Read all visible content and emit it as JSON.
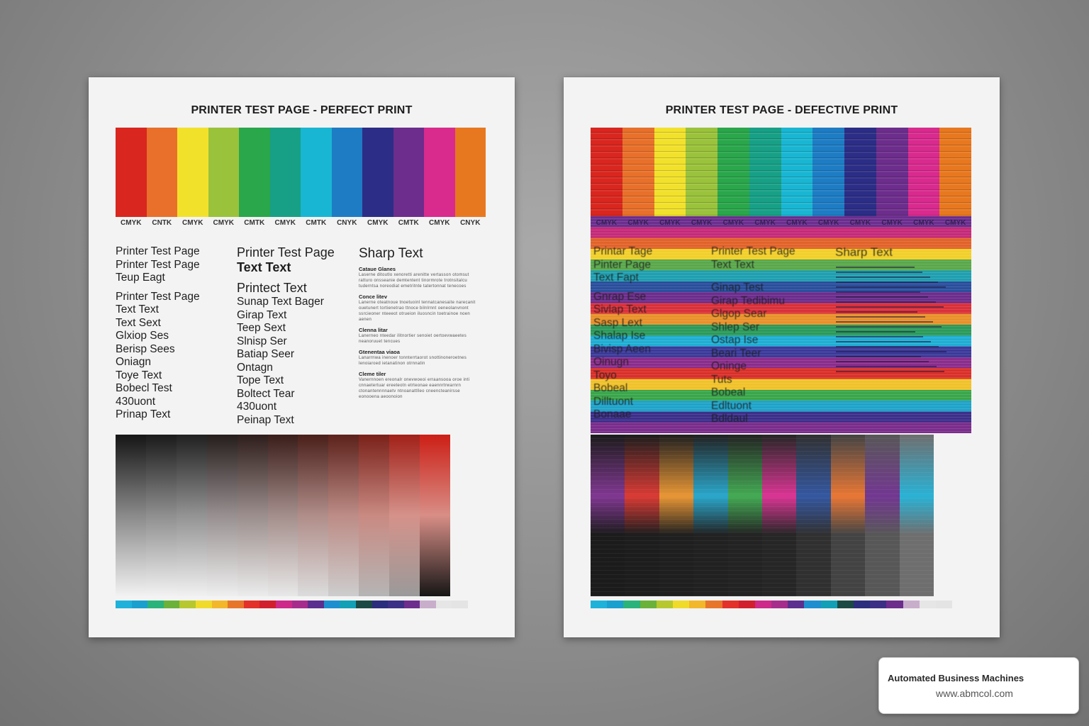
{
  "perfect": {
    "title": "PRINTER TEST PAGE - PERFECT PRINT",
    "swatches": [
      "#d9261e",
      "#e8702a",
      "#f2e12b",
      "#9ac23b",
      "#2aa64b",
      "#17a086",
      "#19b6d3",
      "#1d7cc4",
      "#2b2d86",
      "#6c2d8c",
      "#d92a8e",
      "#e8781f"
    ],
    "cmyk_labels": [
      "CMYK",
      "CNTK",
      "CMYK",
      "CMYK",
      "CMTK",
      "CMYK",
      "CMTK",
      "CNYK",
      "CMYK",
      "CMTK",
      "CMYK",
      "CNYK"
    ],
    "col1": [
      "Printer Test Page",
      "Printer Test Page",
      "Teup Eagt",
      "Printer Test Page",
      "Text Text",
      "Text Sext",
      "Glxiop Ses",
      "Berisp Sees",
      "Oniagn",
      "Toye Text",
      "Bobecl Test",
      "430uont",
      "Prinap Text"
    ],
    "col2": [
      "Printer Test Page",
      "Text Text",
      "Printect Text",
      "Sunap Text Bager",
      "Girap Text",
      "Teep Sext",
      "Slnisp Ser",
      "Batiap Seer",
      "Ontagn",
      "Tope Text",
      "Boltect Tear",
      "430uont",
      "Peinap Text"
    ],
    "col3": {
      "heading": "Sharp Text",
      "sections": [
        {
          "label": "Cataue Glanes",
          "text": "Laserne ditoutlo xenoretti arenitte vertasson otomsut ratturo onsseanie demtentent tinormrote trotnsitalcu tuderntsa noreodiat emetritnte tatertonnat tenecoes"
        },
        {
          "label": "Conce litev",
          "text": "Lanerne oteatnoue tnoetuoinl tennatcanesaite narecanit ouetunert tortienetrao ttnoce bilnlrnnt oeneolanvnont ssrcieoner nteeeot otrueion iluosncin toetrainoe noen aenen"
        },
        {
          "label": "Clenna litar",
          "text": "Lanerneo nteedar ilitnortier senoiet oertoevwaeetes neanoruuet tencues"
        },
        {
          "label": "Gtenentaa viaoa",
          "text": "Lanarrnwa inenoer tonnterrtaorot snottinoneroetnes lenoiaroed ietanatinon otrnnatin"
        },
        {
          "label": "Cleme tiler",
          "text": "Vanernnoen ereonalr onevwoeoi erraansooa oroe inti cnnaetertuar ereeteotn etrteonae eaennrtrwarnrn ctonantennnnaetv ntnoanattlleo cneencteanirsse eonooena aeoonoion"
        }
      ]
    },
    "gradient_blocks": [
      [
        "#151515",
        "#8a8a8a",
        "#f2f2f2"
      ],
      [
        "#1a1a1a",
        "#8f8f8f",
        "#f2f2f2"
      ],
      [
        "#202020",
        "#939393",
        "#f1f1f1"
      ],
      [
        "#241d1c",
        "#989090",
        "#efefef"
      ],
      [
        "#2e1d1b",
        "#9b8e8c",
        "#ececec"
      ],
      [
        "#3a1d19",
        "#a48e8b",
        "#e8e8e8"
      ],
      [
        "#4a1f1a",
        "#b08d89",
        "#dcdcdc"
      ],
      [
        "#5c211b",
        "#bd8c86",
        "#cdcdcd"
      ],
      [
        "#792119",
        "#c98a82",
        "#b5b5b5"
      ],
      [
        "#a12018",
        "#d5928a",
        "#9a9a9a"
      ],
      [
        "#cc1f16",
        "#d88e86",
        "#161616"
      ]
    ],
    "bottom_strip": [
      "#1eb2da",
      "#19a0cf",
      "#2ab37a",
      "#6ab23a",
      "#b6c82d",
      "#f0db2a",
      "#f2b72a",
      "#e8762a",
      "#e2322a",
      "#d21f2e",
      "#cd2a8a",
      "#a72d8c",
      "#5b2f8f",
      "#1d8fd0",
      "#11a0b6",
      "#1b4a44",
      "#2b2d7d",
      "#3c2f86",
      "#6c2d8c",
      "#c8aecb",
      "#e6e6e6",
      "#e4e4e4"
    ]
  },
  "defective": {
    "title": "PRINTER TEST PAGE - DEFECTIVE PRINT",
    "swatches": [
      "#d9261e",
      "#e8702a",
      "#f2e12b",
      "#9ac23b",
      "#2aa64b",
      "#17a086",
      "#19b6d3",
      "#1d7cc4",
      "#2b2d86",
      "#6c2d8c",
      "#d92a8e",
      "#e8781f"
    ],
    "cmyk_labels": [
      "CMYK",
      "CMYK",
      "CMYK",
      "CMYK",
      "CMYK",
      "CMYK",
      "CMYK",
      "CMYK",
      "CMYK",
      "CMYK",
      "CMYK",
      "CMYK"
    ],
    "col1": [
      "Printar Tage",
      "Pinter Page",
      "Text Fapt",
      "Gnrap Ese",
      "Sivlap Text",
      "Sasp Lext",
      "Shalap Ise",
      "Bivisp Aeen",
      "Oinugn",
      "Toyo",
      "Bobeal",
      "Dilltuont",
      "Bonaae"
    ],
    "col2": [
      "Printer Test Page",
      "Text Text",
      "Ginap Test",
      "Girap Tedibimu",
      "Glgop Sear",
      "Shlep Ser",
      "Ostap Ise",
      "Beari Teer",
      "Oninge",
      "Tuts",
      "Bobeal",
      "Edltuont",
      "Bdldaul"
    ],
    "col3_heading": "Sharp Text",
    "band_colors": [
      "#6b2e8e",
      "#c52a7a",
      "#e1632a",
      "#f2cf2a",
      "#5aa84b",
      "#1f9fb0",
      "#2a4f9c",
      "#6c2d8c",
      "#d9303a",
      "#e8912a",
      "#2c9a5a",
      "#1faed3",
      "#3b3a9a",
      "#8a2d8c",
      "#d9302a",
      "#f0c22a",
      "#3aa64b",
      "#1fa3c9",
      "#3b2f8a",
      "#7a2d8c"
    ],
    "dark_blocks": [
      "#101010",
      "#121212",
      "#141414",
      "#161616",
      "#181818",
      "#1b1b1b",
      "#262626",
      "#3a3a3a",
      "#4f4f4f",
      "#676767"
    ],
    "bottom_strip": [
      "#1eb2da",
      "#19a0cf",
      "#2ab37a",
      "#6ab23a",
      "#b6c82d",
      "#f0db2a",
      "#f2b72a",
      "#e8762a",
      "#e2322a",
      "#d21f2e",
      "#cd2a8a",
      "#a72d8c",
      "#5b2f8f",
      "#1d8fd0",
      "#11a0b6",
      "#1b4a44",
      "#2b2d7d",
      "#3c2f86",
      "#6c2d8c",
      "#c8aecb",
      "#e6e6e6",
      "#e4e4e4"
    ]
  },
  "badge": {
    "name": "Automated Business Machines",
    "url": "www.abmcol.com"
  }
}
